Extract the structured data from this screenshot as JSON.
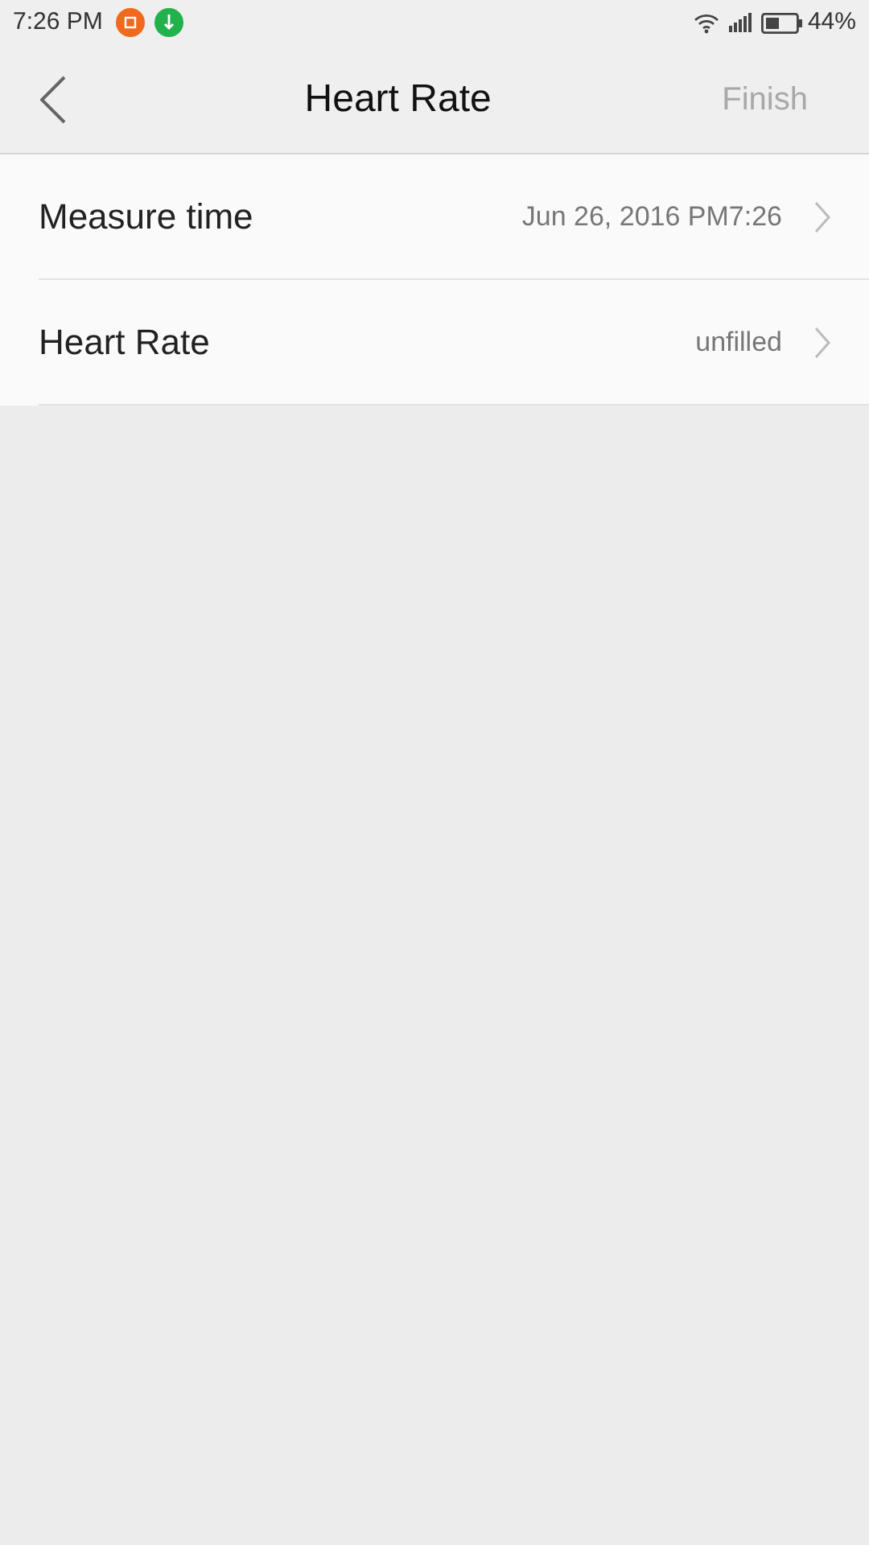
{
  "status_bar": {
    "time": "7:26 PM",
    "battery_text": "44%"
  },
  "header": {
    "title": "Heart Rate",
    "finish_button": {
      "label": "Finish",
      "disabled": true
    }
  },
  "rows": [
    {
      "label": "Measure time",
      "value": "Jun 26, 2016 PM7:26"
    },
    {
      "label": "Heart Rate",
      "value": "unfilled"
    }
  ]
}
